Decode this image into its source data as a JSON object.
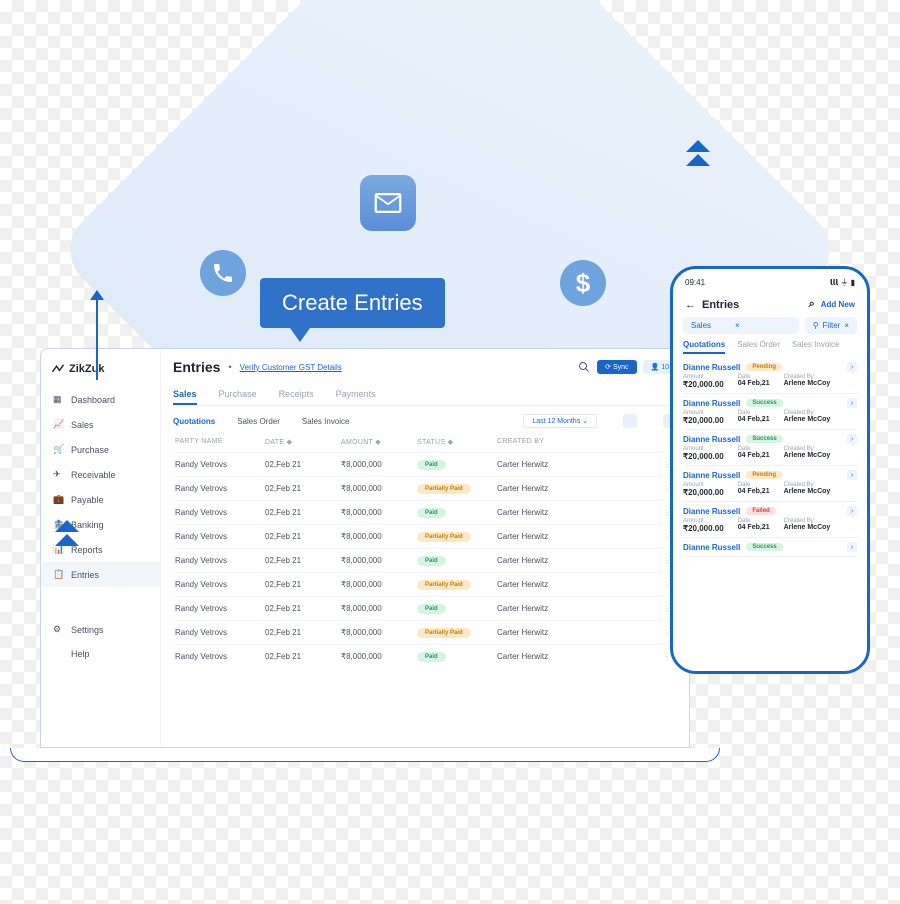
{
  "brand": "ZikZuk",
  "bubble": "Create Entries",
  "sidebar": {
    "items": [
      "Dashboard",
      "Sales",
      "Purchase",
      "Receivable",
      "Payable",
      "Banking",
      "Reports",
      "Entries"
    ],
    "lower": [
      "Settings",
      "Help"
    ],
    "active": "Entries"
  },
  "header": {
    "title": "Entries",
    "verify": "Verify Customer GST Details",
    "sync": "Sync",
    "count": "10"
  },
  "tabs_top": [
    "Sales",
    "Purchase",
    "Receipts",
    "Payments"
  ],
  "tabs_top_active": "Sales",
  "subtabs": [
    "Quotations",
    "Sales Order",
    "Sales Invoice"
  ],
  "subtabs_active": "Quotations",
  "months": "Last 12 Months",
  "table": {
    "headers": {
      "party": "PARTY NAME",
      "date": "DATE",
      "amount": "AMOUNT",
      "status": "STATUS",
      "created": "CREATED BY"
    },
    "rows": [
      {
        "party": "Randy Vetrovs",
        "date": "02,Feb 21",
        "amount": "₹8,000,000",
        "status": "Paid",
        "status_cls": "b-paid",
        "by": "Carter Herwitz"
      },
      {
        "party": "Randy Vetrovs",
        "date": "02,Feb 21",
        "amount": "₹8,000,000",
        "status": "Partially Paid",
        "status_cls": "b-part",
        "by": "Carter Herwitz"
      },
      {
        "party": "Randy Vetrovs",
        "date": "02,Feb 21",
        "amount": "₹8,000,000",
        "status": "Paid",
        "status_cls": "b-paid",
        "by": "Carter Herwitz"
      },
      {
        "party": "Randy Vetrovs",
        "date": "02,Feb 21",
        "amount": "₹8,000,000",
        "status": "Partially Paid",
        "status_cls": "b-part",
        "by": "Carter Herwitz"
      },
      {
        "party": "Randy Vetrovs",
        "date": "02,Feb 21",
        "amount": "₹8,000,000",
        "status": "Paid",
        "status_cls": "b-paid",
        "by": "Carter Herwitz"
      },
      {
        "party": "Randy Vetrovs",
        "date": "02,Feb 21",
        "amount": "₹8,000,000",
        "status": "Partially Paid",
        "status_cls": "b-part",
        "by": "Carter Herwitz"
      },
      {
        "party": "Randy Vetrovs",
        "date": "02,Feb 21",
        "amount": "₹8,000,000",
        "status": "Paid",
        "status_cls": "b-paid",
        "by": "Carter Herwitz"
      },
      {
        "party": "Randy Vetrovs",
        "date": "02,Feb 21",
        "amount": "₹8,000,000",
        "status": "Partially Paid",
        "status_cls": "b-part",
        "by": "Carter Herwitz"
      },
      {
        "party": "Randy Vetrovs",
        "date": "02,Feb 21",
        "amount": "₹8,000,000",
        "status": "Paid",
        "status_cls": "b-paid",
        "by": "Carter Herwitz"
      }
    ]
  },
  "phone": {
    "time": "09:41",
    "title": "Entries",
    "add": "Add New",
    "selector": "Sales",
    "filter": "Filter",
    "tabs": [
      "Quotations",
      "Sales Order",
      "Sales Invoice"
    ],
    "tabs_active": "Quotations",
    "field_labels": {
      "amount": "Amount",
      "date": "Date",
      "created": "Created By"
    },
    "cards": [
      {
        "name": "Dianne Russell",
        "status": "Pending",
        "status_cls": "cb-pending",
        "amount": "₹20,000.00",
        "date": "04 Feb,21",
        "by": "Arlene McCoy"
      },
      {
        "name": "Dianne Russell",
        "status": "Success",
        "status_cls": "cb-success",
        "amount": "₹20,000.00",
        "date": "04 Feb,21",
        "by": "Arlene McCoy"
      },
      {
        "name": "Dianne Russell",
        "status": "Success",
        "status_cls": "cb-success",
        "amount": "₹20,000.00",
        "date": "04 Feb,21",
        "by": "Arlene McCoy"
      },
      {
        "name": "Dianne Russell",
        "status": "Pending",
        "status_cls": "cb-pending",
        "amount": "₹20,000.00",
        "date": "04 Feb,21",
        "by": "Arlene McCoy"
      },
      {
        "name": "Dianne Russell",
        "status": "Failed",
        "status_cls": "cb-failed",
        "amount": "₹20,000.00",
        "date": "04 Feb,21",
        "by": "Arlene McCoy"
      },
      {
        "name": "Dianne Russell",
        "status": "Success",
        "status_cls": "cb-success",
        "amount": "",
        "date": "",
        "by": ""
      }
    ]
  }
}
